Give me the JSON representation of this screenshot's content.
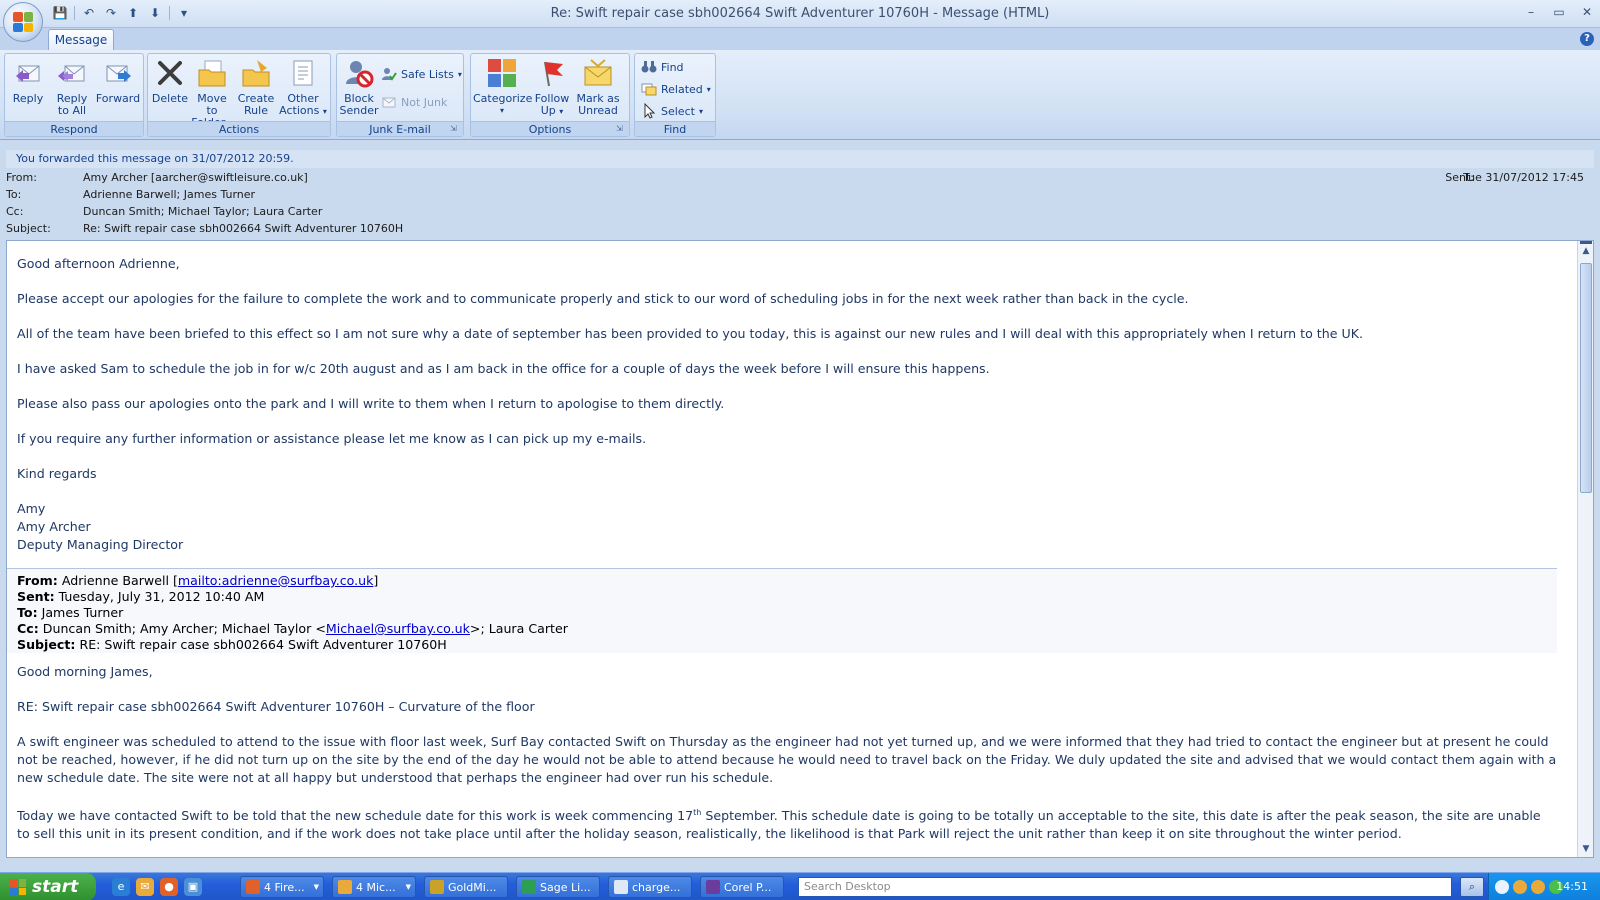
{
  "window": {
    "title": "Re: Swift repair case sbh002664 Swift Adventurer 10760H - Message (HTML)",
    "controls": {
      "minimize": "–",
      "maximize": "▭",
      "close": "✕"
    }
  },
  "qat": {
    "save": "💾",
    "undo": "↶",
    "redo": "↷",
    "prev": "⬆",
    "next": "⬇",
    "customize": "▾"
  },
  "tabs": {
    "message": "Message",
    "help": "?"
  },
  "ribbon": {
    "respond": {
      "label": "Respond",
      "reply": "Reply",
      "reply_all_1": "Reply",
      "reply_all_2": "to All",
      "forward": "Forward"
    },
    "actions": {
      "label": "Actions",
      "delete": "Delete",
      "move_1": "Move to",
      "move_2": "Folder",
      "create_1": "Create",
      "create_2": "Rule",
      "other_1": "Other",
      "other_2": "Actions"
    },
    "junk": {
      "label": "Junk E-mail",
      "block_1": "Block",
      "block_2": "Sender",
      "safe_lists": "Safe Lists",
      "not_junk": "Not Junk"
    },
    "options": {
      "label": "Options",
      "categorize": "Categorize",
      "follow_1": "Follow",
      "follow_2": "Up",
      "mark_1": "Mark as",
      "mark_2": "Unread"
    },
    "find": {
      "label": "Find",
      "find": "Find",
      "related": "Related",
      "select": "Select"
    }
  },
  "infobar": "You forwarded this message on 31/07/2012 20:59.",
  "header": {
    "from_label": "From:",
    "from": "Amy Archer [aarcher@swiftleisure.co.uk]",
    "to_label": "To:",
    "to": "Adrienne Barwell; James Turner",
    "cc_label": "Cc:",
    "cc": "Duncan Smith; Michael Taylor; Laura Carter",
    "subject_label": "Subject:",
    "subject": "Re: Swift repair case sbh002664 Swift Adventurer 10760H",
    "sent_label": "Sent:",
    "sent": "Tue 31/07/2012 17:45"
  },
  "body": {
    "greeting": "Good afternoon Adrienne,",
    "p1": "Please accept our apologies for the failure to complete the work and to communicate properly and stick to our word of scheduling jobs in for the next week rather than back in the cycle.",
    "p2": "All of the team have been briefed to this effect so I am not sure why a date of september has been provided to you today, this is against our new rules and I will deal with this appropriately when I return to the UK.",
    "p3": "I have asked Sam to schedule the job in for w/c 20th august and as I am back in the office for a couple of days the week before I will ensure this happens.",
    "p4": "Please also pass our apologies onto the park and I will write to them when I return to apologise to them directly.",
    "p5": "If you require any further information or assistance please let me know as I can pick up my e-mails.",
    "closing": "Kind regards",
    "sig1": "Amy",
    "sig2": "Amy Archer",
    "sig3": "Deputy Managing Director"
  },
  "original": {
    "from_label": "From:",
    "from_name": "Adrienne Barwell",
    "from_link": "mailto:adrienne@surfbay.co.uk",
    "sent_label": "Sent:",
    "sent": "Tuesday, July 31, 2012 10:40 AM",
    "to_label": "To:",
    "to": "James Turner",
    "cc_label": "Cc:",
    "cc_pre": "Duncan Smith; Amy Archer; Michael Taylor <",
    "cc_link": "Michael@surfbay.co.uk",
    "cc_post": ">; Laura Carter",
    "subject_label": "Subject:",
    "subject": "RE: Swift repair case sbh002664 Swift Adventurer 10760H",
    "greeting": "Good morning James,",
    "re_line": "RE: Swift repair case sbh002664 Swift Adventurer 10760H – Curvature of the floor",
    "p1": "A swift engineer was scheduled to attend to the issue with floor last week, Surf Bay contacted Swift  on Thursday as the engineer had not yet turned up, and we were informed that they had tried to contact the engineer but at present he could not be reached, however, if he did not turn up on the site by the end of the day he would not be able to attend  because he would need to travel back on the Friday.  We duly updated the site and advised that we would contact them again with a new schedule date.  The site were not at all happy but understood that perhaps the engineer had over run his schedule.",
    "p2_a": "Today we have contacted Swift to be told that the new schedule date for this work is week commencing 17",
    "p2_sup": "th",
    "p2_b": " September.  This schedule date is going to be totally un acceptable to the site, this date is after the peak season, the site are unable to sell this unit in its present condition, and if the work does not take place until after the holiday season, realistically, the likelihood is that Park will reject the unit rather than keep it on site throughout the winter period."
  },
  "taskbar": {
    "start": "start",
    "tasks": [
      "4 Fire...",
      "4 Mic...",
      "GoldMi...",
      "Sage Li...",
      "charge...",
      "Corel P..."
    ],
    "search_placeholder": "Search Desktop",
    "clock": "14:51"
  }
}
